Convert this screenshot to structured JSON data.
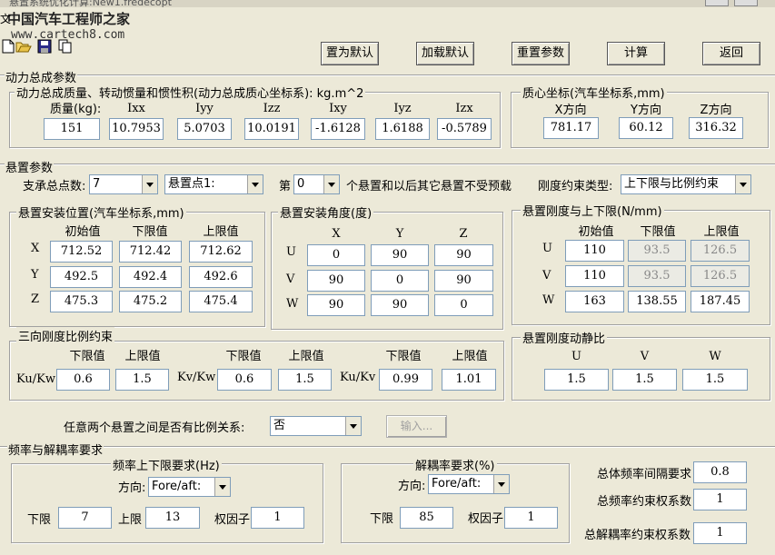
{
  "window": {
    "title": "悬置系统优化计算:New1.fredecopt"
  },
  "watermark": {
    "line1": "中国汽车工程师之家",
    "line2": "www.cartech8.com"
  },
  "menu": {
    "file": "文"
  },
  "toolbar": {
    "set_default": "置为默认",
    "load_default": "加载默认",
    "reset_params": "重置参数",
    "calculate": "计算",
    "back": "返回"
  },
  "powertrain": {
    "section_title": "动力总成参数",
    "inertia_group_title": "动力总成质量、转动惯量和惯性积(动力总成质心坐标系): kg.m^2",
    "mass_label": "质量(kg):",
    "headers": [
      "Ixx",
      "Iyy",
      "Izz",
      "Ixy",
      "Iyz",
      "Izx"
    ],
    "mass": "151",
    "values": [
      "10.7953",
      "5.0703",
      "10.0191",
      "-1.6128",
      "1.6188",
      "-0.5789"
    ],
    "cg_group_title": "质心坐标(汽车坐标系,mm)",
    "cg_headers": [
      "X方向",
      "Y方向",
      "Z方向"
    ],
    "cg_values": [
      "781.17",
      "60.12",
      "316.32"
    ]
  },
  "mount": {
    "section_title": "悬置参数",
    "count_label": "支承总点数:",
    "count_value": "7",
    "point_value": "悬置点1:",
    "nth_label": "第",
    "nth_value": "0",
    "nth_suffix": "个悬置和以后其它悬置不受预载",
    "stiff_type_label": "刚度约束类型:",
    "stiff_type_value": "上下限与比例约束",
    "position": {
      "title": "悬置安装位置(汽车坐标系,mm)",
      "headers": [
        "初始值",
        "下限值",
        "上限值"
      ],
      "rows": [
        {
          "axis": "X",
          "values": [
            "712.52",
            "712.42",
            "712.62"
          ]
        },
        {
          "axis": "Y",
          "values": [
            "492.5",
            "492.4",
            "492.6"
          ]
        },
        {
          "axis": "Z",
          "values": [
            "475.3",
            "475.2",
            "475.4"
          ]
        }
      ]
    },
    "angle": {
      "title": "悬置安装角度(度)",
      "headers": [
        "X",
        "Y",
        "Z"
      ],
      "rows": [
        {
          "axis": "U",
          "values": [
            "0",
            "90",
            "90"
          ]
        },
        {
          "axis": "V",
          "values": [
            "90",
            "0",
            "90"
          ]
        },
        {
          "axis": "W",
          "values": [
            "90",
            "90",
            "0"
          ]
        }
      ]
    },
    "stiffness": {
      "title": "悬置刚度与上下限(N/mm)",
      "headers": [
        "初始值",
        "下限值",
        "上限值"
      ],
      "rows": [
        {
          "axis": "U",
          "values": [
            "110",
            "93.5",
            "126.5"
          ]
        },
        {
          "axis": "V",
          "values": [
            "110",
            "93.5",
            "126.5"
          ]
        },
        {
          "axis": "W",
          "values": [
            "163",
            "138.55",
            "187.45"
          ]
        }
      ]
    },
    "ratio": {
      "title": "三向刚度比例约束",
      "lower": "下限值",
      "upper": "上限值",
      "items": [
        {
          "label": "Ku/Kw",
          "lower": "0.6",
          "upper": "1.5"
        },
        {
          "label": "Kv/Kw",
          "lower": "0.6",
          "upper": "1.5"
        },
        {
          "label": "Ku/Kv",
          "lower": "0.99",
          "upper": "1.01"
        }
      ]
    },
    "dyn": {
      "title": "悬置刚度动静比",
      "headers": [
        "U",
        "V",
        "W"
      ],
      "values": [
        "1.5",
        "1.5",
        "1.5"
      ]
    },
    "prop_label": "任意两个悬置之间是否有比例关系:",
    "prop_value": "否",
    "input_button": "输入..."
  },
  "freq": {
    "section_title": "频率与解耦率要求",
    "range_group_title": "频率上下限要求(Hz)",
    "direction_label": "方向:",
    "direction_value": "Fore/aft:",
    "lower_label": "下限",
    "lower_value": "7",
    "upper_label": "上限",
    "upper_value": "13",
    "weight_label": "权因子",
    "weight_value": "1",
    "decouple_group_title": "解耦率要求(%)",
    "decouple_direction_value": "Fore/aft:",
    "decouple_lower_label": "下限",
    "decouple_lower_value": "85",
    "decouple_weight_label": "权因子",
    "decouple_weight_value": "1",
    "interval_label": "总体频率间隔要求",
    "interval_value": "0.8",
    "freq_weight_label": "总频率约束权系数",
    "freq_weight_value": "1",
    "decouple_total_weight_label": "总解耦率约束权系数",
    "decouple_total_weight_value": "1"
  }
}
